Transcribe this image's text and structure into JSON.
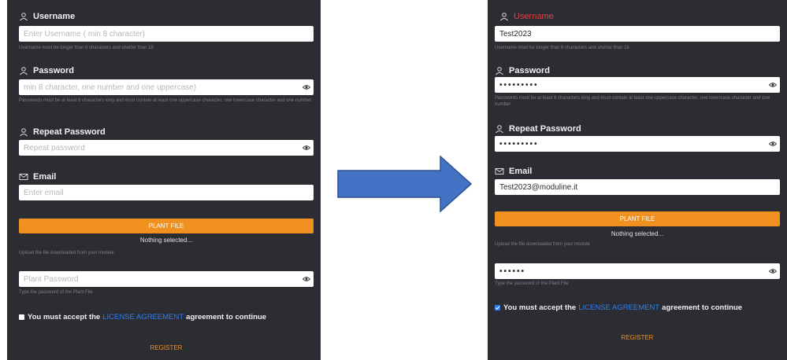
{
  "left": {
    "username": {
      "label": "Username",
      "placeholder": "Enter Username ( min 8 character)",
      "value": "",
      "hint": "Username must be longer than 6 characters and shorter than 18"
    },
    "password": {
      "label": "Password",
      "placeholder": "min 8 character, one number and one uppercase)",
      "value": "",
      "hint": "Passwords must be at least 8 characters long and must contain at least one uppercase character, one lowercase character and one number"
    },
    "repeat_password": {
      "label": "Repeat Password",
      "placeholder": "Repeat password",
      "value": ""
    },
    "email": {
      "label": "Email",
      "placeholder": "Enter email",
      "value": ""
    },
    "plant_file_button": "PLANT FILE",
    "nothing_selected": "Nothing selected...",
    "upload_hint": "Upload the file downloaded from your module",
    "plant_password": {
      "placeholder": "Plant Password",
      "value": "",
      "hint": "Type the password of the Plant File"
    },
    "agreement": {
      "prefix": "You must accept the",
      "link": "LICENSE AGREEMENT",
      "suffix": "agreement to continue",
      "checked": false
    },
    "register_button": "REGISTER"
  },
  "right": {
    "username": {
      "label": "Username",
      "value": "Test2023",
      "hint": "Username must be longer than 6 characters and shorter than 18"
    },
    "password": {
      "label": "Password",
      "masked": "•••••••••",
      "hint": "Passwords must be at least 8 characters long and must contain at least one uppercase character, one lowercase character and one number"
    },
    "repeat_password": {
      "label": "Repeat Password",
      "masked": "•••••••••"
    },
    "email": {
      "label": "Email",
      "value": "Test2023@moduline.it"
    },
    "plant_file_button": "PLANT FILE",
    "nothing_selected": "Nothing selected...",
    "upload_hint": "Upload the file downloaded from your module",
    "plant_password": {
      "masked": "••••••",
      "hint": "Type the password of the Plant File"
    },
    "agreement": {
      "prefix": "You must accept the",
      "link": "LICENSE AGREEMENT",
      "suffix": "agreement to continue",
      "checked": true
    },
    "register_button": "REGISTER"
  },
  "colors": {
    "panel_bg": "#2c2d33",
    "accent_orange": "#f0901e",
    "link_blue": "#2f7df6",
    "error_red": "#d9434a",
    "arrow_fill": "#4472c4",
    "arrow_stroke": "#2f528f"
  },
  "icons": [
    "user-icon",
    "mail-icon",
    "eye-icon",
    "checkbox-icon",
    "arrow-right-icon"
  ]
}
